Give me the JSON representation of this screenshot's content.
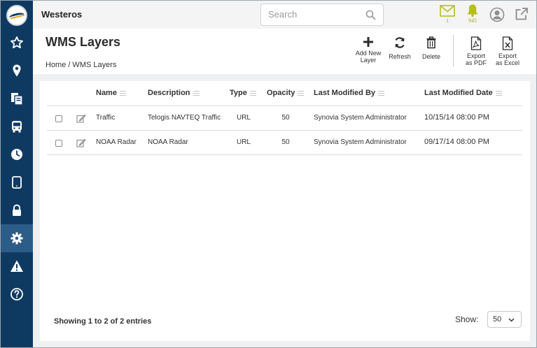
{
  "app": {
    "title": "Westeros"
  },
  "search": {
    "placeholder": "Search"
  },
  "header": {
    "mail_count": "1",
    "alert_count": "945"
  },
  "page": {
    "title": "WMS Layers",
    "breadcrumb": [
      "Home",
      "/",
      "WMS Layers"
    ]
  },
  "toolbar": {
    "add_label_1": "Add New",
    "add_label_2": "Layer",
    "refresh_label": "Refresh",
    "delete_label": "Delete",
    "pdf_label_1": "Export",
    "pdf_label_2": "as PDF",
    "excel_label_1": "Export",
    "excel_label_2": "as Excel"
  },
  "table": {
    "columns": [
      "Name",
      "Description",
      "Type",
      "Opacity",
      "Last Modified By",
      "Last Modified Date"
    ],
    "rows": [
      {
        "name": "Traffic",
        "description": "Telogis NAVTEQ Traffic",
        "type": "URL",
        "opacity": "50",
        "modified_by": "Synovia System Administrator",
        "modified_date": "10/15/14 08:00 PM"
      },
      {
        "name": "NOAA Radar",
        "description": "NOAA Radar",
        "type": "URL",
        "opacity": "50",
        "modified_by": "Synovia System Administrator",
        "modified_date": "09/17/14 08:00 PM"
      }
    ]
  },
  "footer": {
    "showing": "Showing 1 to 2 of 2 entries",
    "show_label": "Show:",
    "page_size": "50"
  },
  "sidebar": {
    "items": [
      "favorites",
      "location",
      "documents",
      "vehicles",
      "history",
      "devices",
      "security",
      "settings",
      "alerts",
      "help"
    ],
    "active": "settings"
  },
  "colors": {
    "sidebar_bg": "#0e3a62",
    "sidebar_active": "#2c5c88",
    "notify_accent": "#b5bd1f"
  }
}
